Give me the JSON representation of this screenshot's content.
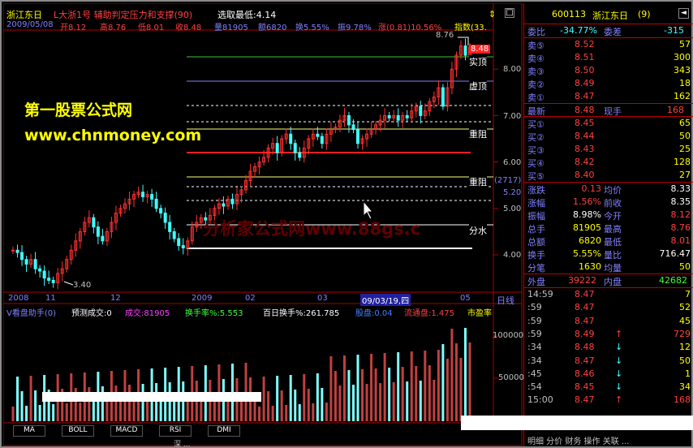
{
  "header": {
    "stock_name": "浙江东日",
    "indicator_name": "L大浙1号 辅助判定压力和支撑(90)",
    "select_label": "选取最低:4.14",
    "date": "2009/05/08",
    "open_label": "开8.12",
    "high_label": "高8.76",
    "low_label": "低8.01",
    "close_label": "收8.48",
    "vol_label": "量81905",
    "amount_label": "额6820",
    "turnover_label": "换5.55%",
    "amplitude_label": "振9.78%",
    "change_label": "涨(0.81)10.56%",
    "index_label": "指数(33."
  },
  "price_chart": {
    "watermark_title": "第一股票公式网",
    "watermark_url": "www.chnmoney.com",
    "watermark2": "分析家公式网www.88gs.c",
    "high_marker": "8.76",
    "low_marker": "3.40",
    "current_price_tag": "8.48",
    "line_labels": [
      "实顶",
      "虚顶",
      "重阻",
      "重阻",
      "分水"
    ],
    "bracket_label": "(2717)",
    "bracket_value": "5.20",
    "y_ticks": [
      "8.00",
      "7.00",
      "6.00",
      "5.00",
      "4.00"
    ],
    "x_ticks": [
      "2008",
      "11",
      "12",
      "2009",
      "02",
      "03",
      "09/03/19,四",
      "05"
    ],
    "period_label": "日线"
  },
  "volume_chart": {
    "indicator": "V看盘助手(0)",
    "items": [
      "预测成交:0",
      "成交:81905",
      "换手率%:5.553",
      "百日换手%:261.785",
      "股盘:0.04",
      "流通盘:1.475",
      "市盈率"
    ],
    "y_ticks": [
      "100000",
      "50000"
    ]
  },
  "tabs": [
    "MA",
    "BOLL",
    "MACD",
    "RSI",
    "DMI"
  ],
  "footer_text": "深  ...",
  "colors": {
    "up": "#ff3030",
    "down": "#40ffff",
    "yellow": "#ffff00",
    "grid": "#b00000",
    "vol_up": "#c04040",
    "vol_down": "#80ffff"
  },
  "side": {
    "code": "600113",
    "name": "浙江东日",
    "count": "(9)",
    "weibi_label": "委比",
    "weibi_value": "-34.77%",
    "weicha_label": "委差",
    "weicha_value": "-315",
    "asks": [
      {
        "label": "卖⑤",
        "price": "8.52",
        "vol": "57"
      },
      {
        "label": "卖④",
        "price": "8.51",
        "vol": "300"
      },
      {
        "label": "卖③",
        "price": "8.50",
        "vol": "343"
      },
      {
        "label": "卖②",
        "price": "8.49",
        "vol": "18"
      },
      {
        "label": "卖①",
        "price": "8.47",
        "vol": "162"
      }
    ],
    "last_label": "最新",
    "last_price": "8.48",
    "hand_label": "现手",
    "hand_value": "168",
    "bids": [
      {
        "label": "买①",
        "price": "8.45",
        "vol": "65"
      },
      {
        "label": "买②",
        "price": "8.44",
        "vol": "50"
      },
      {
        "label": "买③",
        "price": "8.43",
        "vol": "25"
      },
      {
        "label": "买④",
        "price": "8.42",
        "vol": "128"
      },
      {
        "label": "买⑤",
        "price": "8.40",
        "vol": "27"
      }
    ],
    "stats": [
      {
        "l1": "涨跌",
        "v1": "0.13",
        "l2": "均价",
        "v2": "8.33"
      },
      {
        "l1": "涨幅",
        "v1": "1.56%",
        "l2": "前收",
        "v2": "8.35"
      },
      {
        "l1": "振幅",
        "v1": "8.98%",
        "l2": "今开",
        "v2": "8.12"
      },
      {
        "l1": "总手",
        "v1": "81905",
        "l2": "最高",
        "v2": "8.76"
      },
      {
        "l1": "总额",
        "v1": "6820",
        "l2": "最低",
        "v2": "8.01"
      },
      {
        "l1": "换手",
        "v1": "5.55%",
        "l2": "量比",
        "v2": "716.47"
      },
      {
        "l1": "分笔",
        "v1": "1630",
        "l2": "均量",
        "v2": "50"
      }
    ],
    "outer_label": "外盘",
    "outer_value": "39222",
    "inner_label": "内盘",
    "inner_value": "42682",
    "ticks": [
      {
        "time": "14:59",
        "price": "8.47",
        "arrow": "",
        "vol": "7"
      },
      {
        "time": ":59",
        "price": "8.47",
        "arrow": "",
        "vol": "52"
      },
      {
        "time": ":59",
        "price": "8.47",
        "arrow": "",
        "vol": "45"
      },
      {
        "time": ":59",
        "price": "8.49",
        "arrow": "↑",
        "vol": "729"
      },
      {
        "time": ":34",
        "price": "8.48",
        "arrow": "↓",
        "vol": "12"
      },
      {
        "time": ":34",
        "price": "8.47",
        "arrow": "↓",
        "vol": "50"
      },
      {
        "time": ":45",
        "price": "8.46",
        "arrow": "↓",
        "vol": "1"
      },
      {
        "time": ":54",
        "price": "8.45",
        "arrow": "↓",
        "vol": "34"
      },
      {
        "time": "15:00",
        "price": "8.47",
        "arrow": "↑",
        "vol": "168"
      }
    ],
    "bottom_bar": "明细 分价 财务 操作 关联 ..."
  }
}
